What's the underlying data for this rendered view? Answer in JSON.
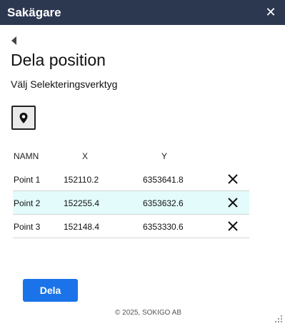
{
  "window": {
    "title": "Sakägare",
    "close_glyph": "✕"
  },
  "panel": {
    "heading": "Dela position",
    "subheading": "Välj Selekteringsverktyg",
    "tool_icon": "map-pin-icon"
  },
  "table": {
    "headers": {
      "name": "NAMN",
      "x": "X",
      "y": "Y"
    },
    "rows": [
      {
        "name": "Point 1",
        "x": "152110.2",
        "y": "6353641.8",
        "selected": false
      },
      {
        "name": "Point 2",
        "x": "152255.4",
        "y": "6353632.6",
        "selected": true
      },
      {
        "name": "Point 3",
        "x": "152148.4",
        "y": "6353330.6",
        "selected": false
      }
    ]
  },
  "actions": {
    "share_label": "Dela"
  },
  "footer": {
    "copyright": "© 2025, SOKIGO AB"
  },
  "colors": {
    "titlebar": "#2c3850",
    "primary": "#1a73e8",
    "selected_row": "#e3fbfb"
  }
}
